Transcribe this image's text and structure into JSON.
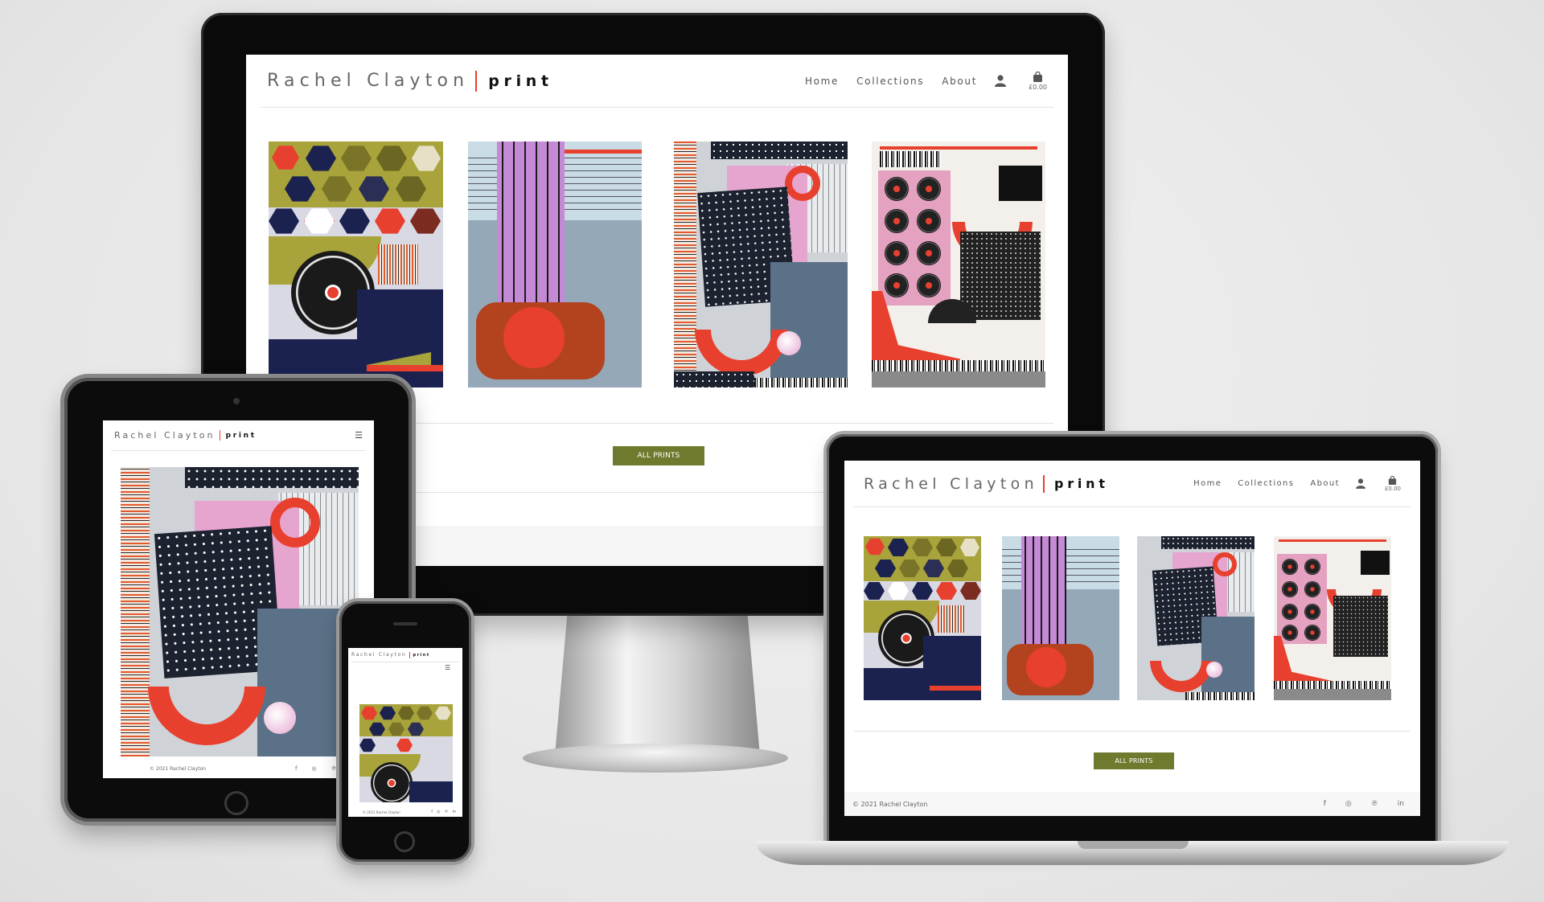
{
  "site": {
    "brand_name": "Rachel Clayton",
    "brand_suffix": "print",
    "nav": [
      {
        "label": "Home"
      },
      {
        "label": "Collections"
      },
      {
        "label": "About"
      }
    ],
    "cart_total": "£0.00",
    "cta_label": "ALL PRINTS",
    "copyright": "© 2021 Rachel Clayton",
    "menu_icon": "☰",
    "social": [
      "f",
      "◎",
      "℗",
      "in"
    ]
  },
  "icons": {
    "account": "user-icon",
    "cart": "shopping-bag-icon",
    "menu": "hamburger-menu-icon"
  },
  "colors": {
    "accent": "#e8402e",
    "button": "#6f7a2e",
    "olive": "#a8a33a",
    "navy": "#1c2250"
  }
}
